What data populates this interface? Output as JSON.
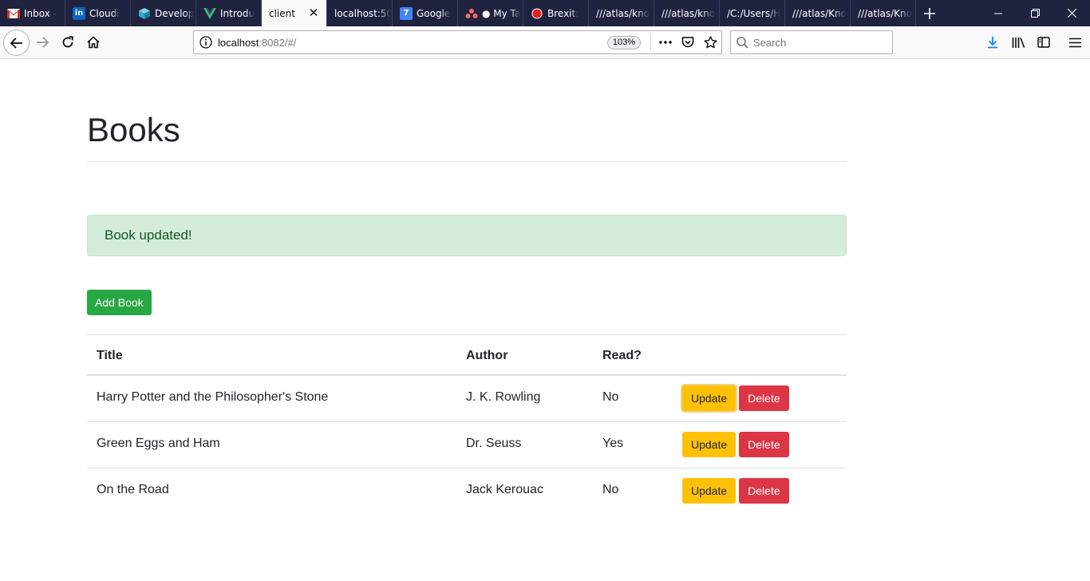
{
  "browser": {
    "tabs": [
      {
        "title": "Inbox -",
        "icon": "gmail-icon",
        "active": false
      },
      {
        "title": "Cloudi",
        "icon": "linkedin-icon",
        "active": false
      },
      {
        "title": "Develop",
        "icon": "cube-icon",
        "active": false
      },
      {
        "title": "Introdu",
        "icon": "vue-icon",
        "active": false
      },
      {
        "title": "client",
        "icon": "",
        "active": true
      },
      {
        "title": "localhost:50",
        "icon": "",
        "active": false
      },
      {
        "title": "Google",
        "icon": "google-calendar-icon",
        "active": false
      },
      {
        "title": "● My Ta",
        "icon": "asana-icon",
        "active": false
      },
      {
        "title": "Brexit: ",
        "icon": "record-icon",
        "active": false
      },
      {
        "title": "///atlas/kno",
        "icon": "",
        "active": false
      },
      {
        "title": "///atlas/kno",
        "icon": "",
        "active": false
      },
      {
        "title": "/C:/Users/H",
        "icon": "",
        "active": false
      },
      {
        "title": "///atlas/Kno",
        "icon": "",
        "active": false
      },
      {
        "title": "///atlas/Kno",
        "icon": "",
        "active": false
      }
    ],
    "url_host": "localhost",
    "url_rest": ":8082/#/",
    "zoom": "103%",
    "search_placeholder": "Search",
    "colors": {
      "tabstrip": "#202340"
    }
  },
  "page": {
    "title": "Books",
    "alert": "Book updated!",
    "add_button": "Add Book",
    "table": {
      "headers": {
        "title": "Title",
        "author": "Author",
        "read": "Read?"
      },
      "rows": [
        {
          "title": "Harry Potter and the Philosopher's Stone",
          "author": "J. K. Rowling",
          "read": "No"
        },
        {
          "title": "Green Eggs and Ham",
          "author": "Dr. Seuss",
          "read": "Yes"
        },
        {
          "title": "On the Road",
          "author": "Jack Kerouac",
          "read": "No"
        }
      ],
      "update_label": "Update",
      "delete_label": "Delete"
    },
    "colors": {
      "success": "#28a745",
      "warning": "#ffc107",
      "danger": "#dc3545",
      "alert_bg": "#d4edda"
    }
  }
}
